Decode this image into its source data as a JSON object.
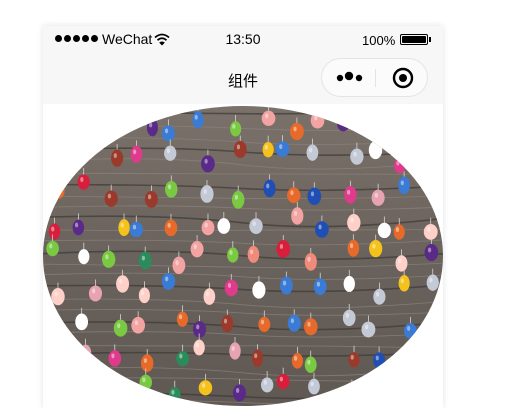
{
  "status_bar": {
    "carrier": "WeChat",
    "time": "13:50",
    "battery": "100%",
    "icons": [
      "signal-dots-icon",
      "wifi-icon",
      "battery-icon"
    ]
  },
  "nav_bar": {
    "title": "组件",
    "capsule": {
      "more_icon": "more-dots-icon",
      "close_icon": "target-close-icon"
    }
  },
  "content": {
    "image_description_icon": "photo-hanging-eggs"
  },
  "colors": {
    "bar_bg": "#f7f7f7",
    "wood": "#6e6660",
    "capsule_border": "#e4e4e4"
  }
}
